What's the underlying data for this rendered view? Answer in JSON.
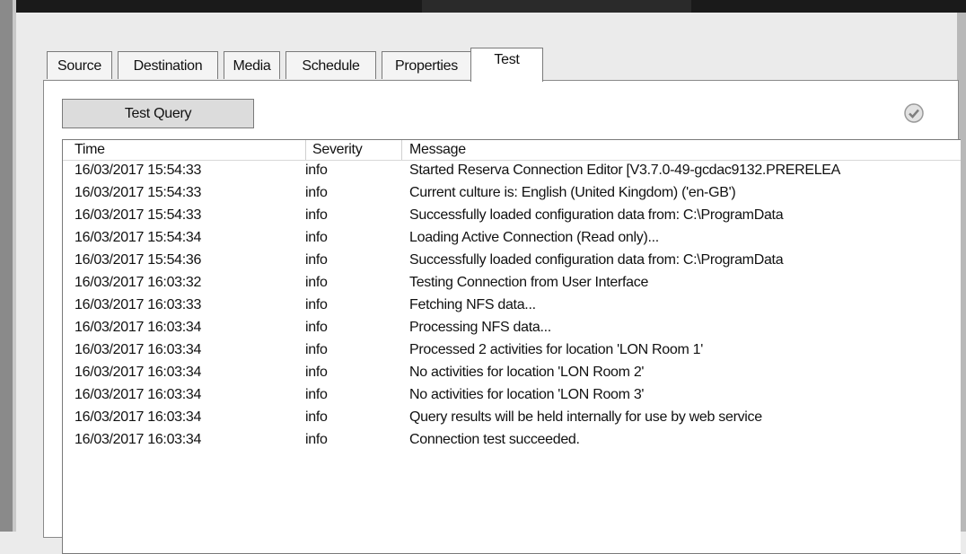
{
  "tabs": [
    {
      "label": "Source"
    },
    {
      "label": "Destination"
    },
    {
      "label": "Media"
    },
    {
      "label": "Schedule"
    },
    {
      "label": "Properties"
    },
    {
      "label": "Test",
      "active": true
    }
  ],
  "test_query_button": "Test Query",
  "status_icon": "check-circle-icon",
  "log": {
    "columns": {
      "time": "Time",
      "severity": "Severity",
      "message": "Message"
    },
    "rows": [
      {
        "time": "16/03/2017 15:54:33",
        "severity": "info",
        "message": "Started Reserva Connection Editor [V3.7.0-49-gcdac9132.PRERELEA"
      },
      {
        "time": "16/03/2017 15:54:33",
        "severity": "info",
        "message": "Current culture is: English (United Kingdom) ('en-GB')"
      },
      {
        "time": "16/03/2017 15:54:33",
        "severity": "info",
        "message": "Successfully loaded configuration data from: C:\\ProgramData"
      },
      {
        "time": "16/03/2017 15:54:34",
        "severity": "info",
        "message": "Loading Active Connection (Read only)..."
      },
      {
        "time": "16/03/2017 15:54:36",
        "severity": "info",
        "message": "Successfully loaded configuration data from: C:\\ProgramData"
      },
      {
        "time": "16/03/2017 16:03:32",
        "severity": "info",
        "message": "Testing Connection from User Interface"
      },
      {
        "time": "16/03/2017 16:03:33",
        "severity": "info",
        "message": "Fetching NFS data..."
      },
      {
        "time": "16/03/2017 16:03:34",
        "severity": "info",
        "message": "Processing NFS data..."
      },
      {
        "time": "16/03/2017 16:03:34",
        "severity": "info",
        "message": "Processed 2 activities for location 'LON Room 1'"
      },
      {
        "time": "16/03/2017 16:03:34",
        "severity": "info",
        "message": "No activities for location 'LON Room 2'"
      },
      {
        "time": "16/03/2017 16:03:34",
        "severity": "info",
        "message": "No activities for location 'LON Room 3'"
      },
      {
        "time": "16/03/2017 16:03:34",
        "severity": "info",
        "message": "Query results will be held internally for use by web service"
      },
      {
        "time": "16/03/2017 16:03:34",
        "severity": "info",
        "message": "Connection test succeeded."
      }
    ]
  }
}
